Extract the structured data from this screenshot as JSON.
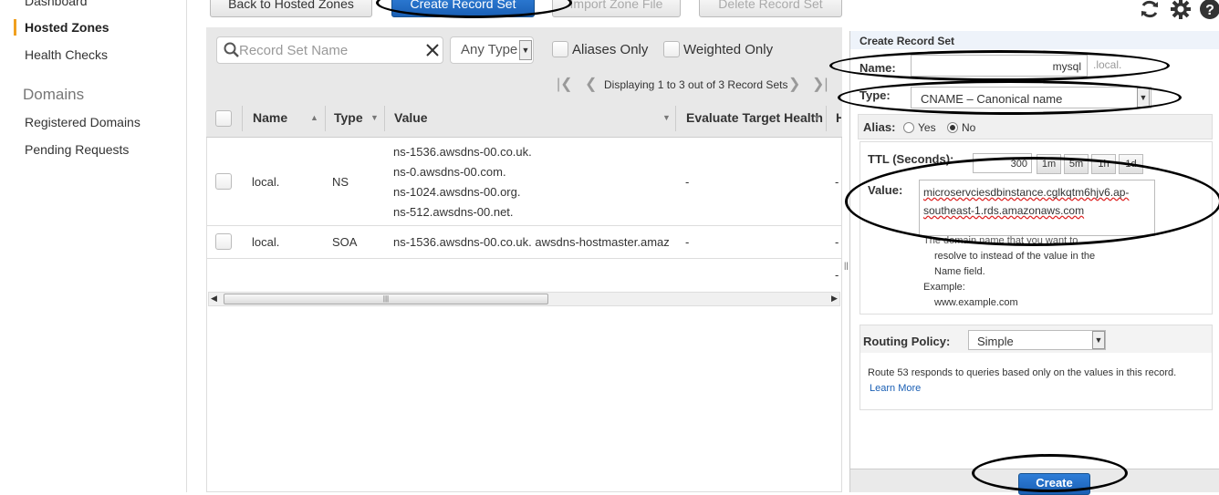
{
  "sidebar": {
    "items": [
      {
        "label": "Dashboard"
      },
      {
        "label": "Hosted Zones"
      },
      {
        "label": "Health Checks"
      }
    ],
    "section_title": "Domains",
    "domain_items": [
      {
        "label": "Registered Domains"
      },
      {
        "label": "Pending Requests"
      }
    ]
  },
  "toolbar": {
    "back_label": "Back to Hosted Zones",
    "create_label": "Create Record Set",
    "import_label": "Import Zone File",
    "delete_label": "Delete Record Set",
    "icons": [
      "refresh-icon",
      "gear-icon",
      "help-icon"
    ]
  },
  "filters": {
    "search_placeholder": "Record Set Name",
    "type_value": "Any Type",
    "aliases_label": "Aliases Only",
    "weighted_label": "Weighted Only"
  },
  "pager": {
    "text": "Displaying 1 to 3 out of 3 Record Sets"
  },
  "table": {
    "columns": [
      "Name",
      "Type",
      "Value",
      "Evaluate Target Health",
      "H"
    ],
    "rows": [
      {
        "name": "local.",
        "type": "NS",
        "values": [
          "ns-1536.awsdns-00.co.uk.",
          "ns-0.awsdns-00.com.",
          "ns-1024.awsdns-00.org.",
          "ns-512.awsdns-00.net."
        ],
        "evaluate": "-",
        "h": "-"
      },
      {
        "name": "local.",
        "type": "SOA",
        "values": [
          "ns-1536.awsdns-00.co.uk. awsdns-hostmaster.amaz"
        ],
        "evaluate": "-",
        "h": "-"
      },
      {
        "name": "",
        "type": "",
        "values": [
          ""
        ],
        "evaluate": "",
        "h": "-"
      }
    ]
  },
  "panel": {
    "title": "Create Record Set",
    "name_label": "Name:",
    "name_value": "mysql",
    "name_suffix": ".local.",
    "type_label": "Type:",
    "type_value": "CNAME – Canonical name",
    "alias_label": "Alias:",
    "alias_yes": "Yes",
    "alias_no": "No",
    "alias_selected": "No",
    "ttl_label": "TTL (Seconds):",
    "ttl_value": "300",
    "ttl_buttons": [
      "1m",
      "5m",
      "1h",
      "1d"
    ],
    "value_label": "Value:",
    "value_text_1": "microservciesdbinstance.cglkqtm6hjv6.ap-",
    "value_text_2": "southeast-1.rds.amazonaws.com",
    "help_1": "The domain name that you want to",
    "help_2": "resolve to instead of the value in the",
    "help_3": "Name field.",
    "help_4": "Example:",
    "help_5": "www.example.com",
    "routing_label": "Routing Policy:",
    "routing_value": "Simple",
    "routing_desc": "Route 53 responds to queries based only on the values in this record.",
    "learn_more": "Learn More",
    "create_button": "Create"
  }
}
